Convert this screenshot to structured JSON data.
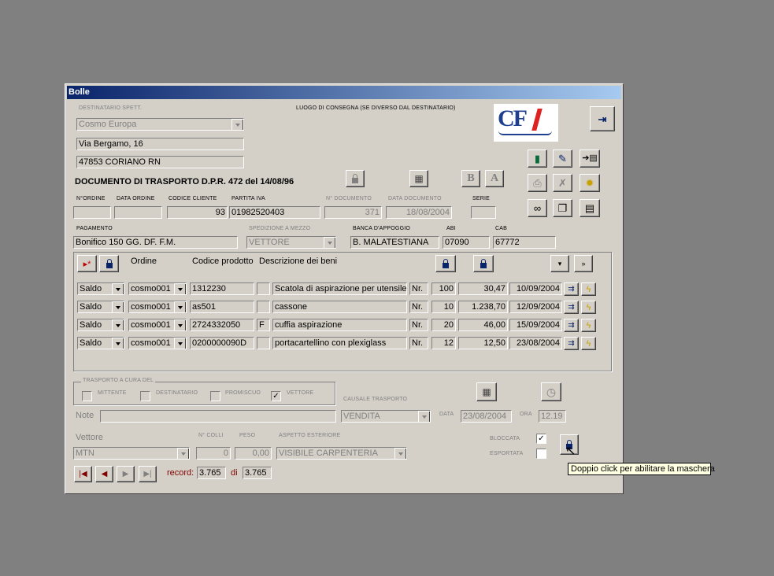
{
  "window": {
    "title": "Bolle"
  },
  "labels": {
    "destinatario": "DESTINATARIO SPETT.",
    "luogo_consegna": "LUOGO DI CONSEGNA (SE DIVERSO DAL DESTINATARIO)",
    "documento_title": "DOCUMENTO DI TRASPORTO D.P.R. 472 del 14/08/96",
    "n_ordine": "N°ORDINE",
    "data_ordine": "DATA ORDINE",
    "codice_cliente": "CODICE CLIENTE",
    "partita_iva": "PARTITA IVA",
    "n_documento": "N° DOCUMENTO",
    "data_documento": "DATA DOCUMENTO",
    "serie": "SERIE",
    "pagamento": "PAGAMENTO",
    "spedizione": "SPEDIZIONE A MEZZO",
    "banca": "BANCA D'APPOGGIO",
    "abi": "ABI",
    "cab": "CAB",
    "ordine": "Ordine",
    "codice_prodotto": "Codice prodotto",
    "descrizione": "Descrizione dei beni",
    "trasporto": "TRASPORTO A CURA DEL",
    "mittente": "MITTENTE",
    "destinatario_chk": "DESTINATARIO",
    "promiscuo": "PROMISCUO",
    "vettore_chk": "VETTORE",
    "causale": "CAUSALE TRASPORTO",
    "note": "Note",
    "data": "DATA",
    "ora": "ORA",
    "vettore": "Vettore",
    "n_colli": "N° COLLI",
    "peso": "PESO",
    "aspetto": "ASPETTO ESTERIORE",
    "bloccata": "BLOCCATA",
    "esportata": "ESPORTATA",
    "record": "record:",
    "di": "di"
  },
  "header": {
    "destinatario": "Cosmo Europa",
    "indirizzo": "Via Bergamo, 16",
    "citta": "47853 CORIANO RN",
    "logo_text": "CF"
  },
  "doc": {
    "n_ordine": "",
    "data_ordine": "",
    "codice_cliente": "93",
    "partita_iva": "01982520403",
    "n_documento": "371",
    "data_documento": "18/08/2004",
    "serie": "",
    "pagamento": "Bonifico 150 GG. DF. F.M.",
    "spedizione": "VETTORE",
    "banca": "B. MALATESTIANA",
    "abi": "07090",
    "cab": "67772"
  },
  "rows": [
    {
      "tipo": "Saldo",
      "ordine": "cosmo001",
      "codice": "1312230",
      "flag": "",
      "descrizione": "Scatola di aspirazione per utensile c",
      "um": "Nr.",
      "qta": "100",
      "prezzo": "30,47",
      "data": "10/09/2004"
    },
    {
      "tipo": "Saldo",
      "ordine": "cosmo001",
      "codice": "as501",
      "flag": "",
      "descrizione": "cassone",
      "um": "Nr.",
      "qta": "10",
      "prezzo": "1.238,70",
      "data": "12/09/2004"
    },
    {
      "tipo": "Saldo",
      "ordine": "cosmo001",
      "codice": "2724332050",
      "flag": "F",
      "descrizione": "cuffia aspirazione",
      "um": "Nr.",
      "qta": "20",
      "prezzo": "46,00",
      "data": "15/09/2004"
    },
    {
      "tipo": "Saldo",
      "ordine": "cosmo001",
      "codice": "0200000090D",
      "flag": "",
      "descrizione": "portacartellino con plexiglass",
      "um": "Nr.",
      "qta": "12",
      "prezzo": "12,50",
      "data": "23/08/2004"
    }
  ],
  "trasporto": {
    "vettore_checked": "✓",
    "causale": "VENDITA",
    "note": "",
    "data": "23/08/2004",
    "ora": "12.19",
    "vettore": "MTN",
    "n_colli": "0",
    "peso": "0,00",
    "aspetto": "VISIBILE CARPENTERIA",
    "bloccata_checked": "✓"
  },
  "nav": {
    "record": "3.765",
    "total": "3.765"
  },
  "tooltip": "Doppio click per abilitare la maschera",
  "icons": [
    "exit-icon",
    "book-icon",
    "edit-icon",
    "import-icon",
    "print-icon",
    "delete-icon",
    "new-icon",
    "binoculars-icon",
    "copy-icon",
    "card-icon",
    "lock-icon",
    "calculator-icon",
    "bold-icon",
    "font-icon",
    "clock-icon"
  ]
}
